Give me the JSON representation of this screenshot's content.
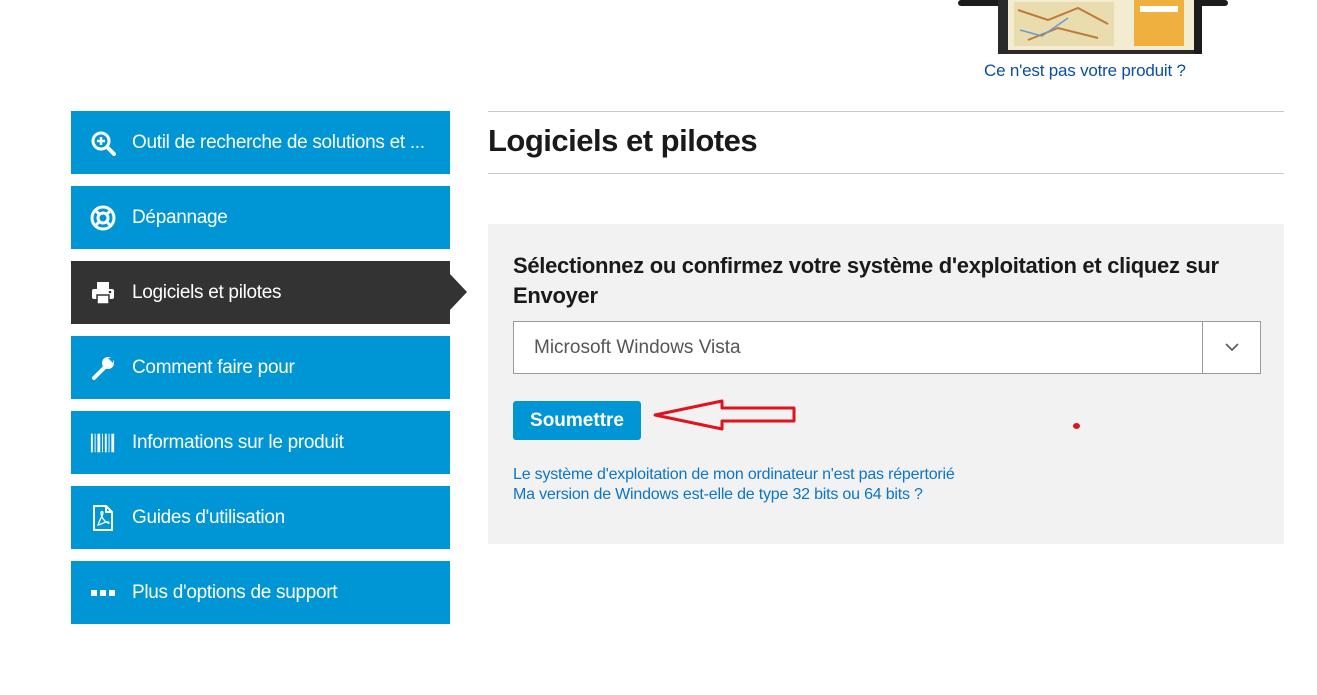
{
  "product": {
    "image_icon": "printer-product-image",
    "not_your_product": "Ce n'est pas votre produit ?"
  },
  "sidebar": {
    "items": [
      {
        "label": "Outil de recherche de solutions et ...",
        "icon": "search-plus-icon",
        "active": false
      },
      {
        "label": "Dépannage",
        "icon": "lifebuoy-icon",
        "active": false
      },
      {
        "label": "Logiciels et pilotes",
        "icon": "printer-icon",
        "active": true
      },
      {
        "label": "Comment faire pour",
        "icon": "wrench-icon",
        "active": false
      },
      {
        "label": "Informations sur le produit",
        "icon": "barcode-icon",
        "active": false
      },
      {
        "label": "Guides d'utilisation",
        "icon": "pdf-document-icon",
        "active": false
      },
      {
        "label": "Plus d'options de support",
        "icon": "more-dots-icon",
        "active": false
      }
    ]
  },
  "main": {
    "title": "Logiciels et pilotes",
    "panel": {
      "heading": "Sélectionnez ou confirmez votre système d'exploitation et cliquez sur Envoyer",
      "os_selected": "Microsoft Windows Vista",
      "submit_label": "Soumettre",
      "link_not_listed": "Le système d'exploitation de mon ordinateur n'est pas répertorié",
      "link_32_64": "Ma version de Windows est-elle de type 32 bits ou 64 bits ?"
    }
  },
  "colors": {
    "accent": "#0096d6",
    "active_nav": "#333333",
    "panel_bg": "#f2f2f2",
    "link": "#0b75c9",
    "annotation": "#e0121d"
  }
}
